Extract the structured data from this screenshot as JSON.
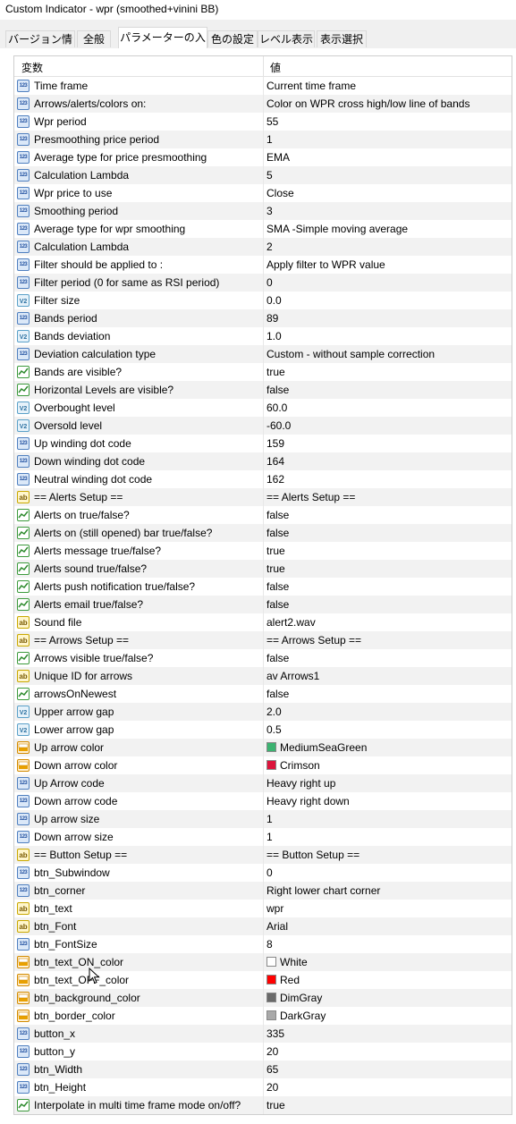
{
  "window": {
    "title": "Custom Indicator - wpr (smoothed+vinini BB)"
  },
  "tabs": [
    {
      "label": "バージョン情報"
    },
    {
      "label": "全般"
    },
    {
      "label": "パラメーターの入力"
    },
    {
      "label": "色の設定"
    },
    {
      "label": "レベル表示"
    },
    {
      "label": "表示選択"
    }
  ],
  "table": {
    "headers": {
      "variable": "変数",
      "value": "値"
    },
    "rows": [
      {
        "icon": "int-icon",
        "name": "Time frame",
        "value": "Current time frame"
      },
      {
        "icon": "int-icon",
        "name": "Arrows/alerts/colors on:",
        "value": "Color on WPR cross high/low line of bands"
      },
      {
        "icon": "int-icon",
        "name": "Wpr period",
        "value": "55"
      },
      {
        "icon": "int-icon",
        "name": "Presmoothing price period",
        "value": "1"
      },
      {
        "icon": "int-icon",
        "name": "Average type for price presmoothing",
        "value": "EMA"
      },
      {
        "icon": "int-icon",
        "name": "Calculation Lambda",
        "value": "5"
      },
      {
        "icon": "int-icon",
        "name": "Wpr price to use",
        "value": "Close"
      },
      {
        "icon": "int-icon",
        "name": "Smoothing period",
        "value": "3"
      },
      {
        "icon": "int-icon",
        "name": "Average type for wpr smoothing",
        "value": "SMA -Simple moving average"
      },
      {
        "icon": "int-icon",
        "name": "Calculation Lambda",
        "value": "2"
      },
      {
        "icon": "int-icon",
        "name": "Filter should be applied to :",
        "value": "Apply filter to WPR value"
      },
      {
        "icon": "int-icon",
        "name": "Filter period (0 for same as RSI period)",
        "value": "0"
      },
      {
        "icon": "double-icon",
        "name": "Filter size",
        "value": "0.0"
      },
      {
        "icon": "int-icon",
        "name": "Bands period",
        "value": "89"
      },
      {
        "icon": "double-icon",
        "name": "Bands deviation",
        "value": "1.0"
      },
      {
        "icon": "int-icon",
        "name": "Deviation calculation type",
        "value": "Custom - without sample correction"
      },
      {
        "icon": "bool-icon",
        "name": "Bands are visible?",
        "value": "true"
      },
      {
        "icon": "bool-icon",
        "name": "Horizontal Levels are visible?",
        "value": "false"
      },
      {
        "icon": "double-icon",
        "name": "Overbought level",
        "value": "60.0"
      },
      {
        "icon": "double-icon",
        "name": "Oversold level",
        "value": "-60.0"
      },
      {
        "icon": "int-icon",
        "name": "Up winding dot code",
        "value": "159"
      },
      {
        "icon": "int-icon",
        "name": "Down winding dot code",
        "value": "164"
      },
      {
        "icon": "int-icon",
        "name": "Neutral winding dot code",
        "value": "162"
      },
      {
        "icon": "string-icon",
        "name": "== Alerts Setup ==",
        "value": "== Alerts Setup =="
      },
      {
        "icon": "bool-icon",
        "name": "Alerts on true/false?",
        "value": "false"
      },
      {
        "icon": "bool-icon",
        "name": "Alerts on (still opened) bar true/false?",
        "value": "false"
      },
      {
        "icon": "bool-icon",
        "name": "Alerts message true/false?",
        "value": "true"
      },
      {
        "icon": "bool-icon",
        "name": "Alerts sound true/false?",
        "value": "true"
      },
      {
        "icon": "bool-icon",
        "name": "Alerts push notification true/false?",
        "value": "false"
      },
      {
        "icon": "bool-icon",
        "name": "Alerts email true/false?",
        "value": "false"
      },
      {
        "icon": "string-icon",
        "name": "Sound file",
        "value": "alert2.wav"
      },
      {
        "icon": "string-icon",
        "name": "== Arrows Setup ==",
        "value": "== Arrows Setup =="
      },
      {
        "icon": "bool-icon",
        "name": "Arrows visible true/false?",
        "value": "false"
      },
      {
        "icon": "string-icon",
        "name": "Unique ID for arrows",
        "value": " av Arrows1"
      },
      {
        "icon": "bool-icon",
        "name": "arrowsOnNewest",
        "value": "false"
      },
      {
        "icon": "double-icon",
        "name": "Upper arrow gap",
        "value": "2.0"
      },
      {
        "icon": "double-icon",
        "name": "Lower arrow gap",
        "value": "0.5"
      },
      {
        "icon": "color-icon",
        "name": "Up arrow color",
        "value": "MediumSeaGreen",
        "swatch": "#3cb371"
      },
      {
        "icon": "color-icon",
        "name": "Down arrow color",
        "value": "Crimson",
        "swatch": "#dc143c"
      },
      {
        "icon": "int-icon",
        "name": "Up Arrow code",
        "value": "Heavy right up"
      },
      {
        "icon": "int-icon",
        "name": "Down arrow code",
        "value": "Heavy right down"
      },
      {
        "icon": "int-icon",
        "name": "Up arrow size",
        "value": "1"
      },
      {
        "icon": "int-icon",
        "name": "Down arrow size",
        "value": "1"
      },
      {
        "icon": "string-icon",
        "name": "== Button Setup ==",
        "value": "== Button Setup =="
      },
      {
        "icon": "int-icon",
        "name": "btn_Subwindow",
        "value": "0"
      },
      {
        "icon": "int-icon",
        "name": "btn_corner",
        "value": "Right lower chart corner"
      },
      {
        "icon": "string-icon",
        "name": "btn_text",
        "value": "wpr"
      },
      {
        "icon": "string-icon",
        "name": "btn_Font",
        "value": "Arial"
      },
      {
        "icon": "int-icon",
        "name": "btn_FontSize",
        "value": "8"
      },
      {
        "icon": "color-icon",
        "name": "btn_text_ON_color",
        "value": "White",
        "swatch": "#ffffff"
      },
      {
        "icon": "color-icon",
        "name": "btn_text_OFF_color",
        "value": "Red",
        "swatch": "#ff0000"
      },
      {
        "icon": "color-icon",
        "name": "btn_background_color",
        "value": "DimGray",
        "swatch": "#696969"
      },
      {
        "icon": "color-icon",
        "name": "btn_border_color",
        "value": "DarkGray",
        "swatch": "#a9a9a9"
      },
      {
        "icon": "int-icon",
        "name": "button_x",
        "value": "335"
      },
      {
        "icon": "int-icon",
        "name": "button_y",
        "value": "20"
      },
      {
        "icon": "int-icon",
        "name": "btn_Width",
        "value": "65"
      },
      {
        "icon": "int-icon",
        "name": "btn_Height",
        "value": "20"
      },
      {
        "icon": "bool-icon",
        "name": "Interpolate in multi time frame mode on/off?",
        "value": "true"
      }
    ]
  }
}
